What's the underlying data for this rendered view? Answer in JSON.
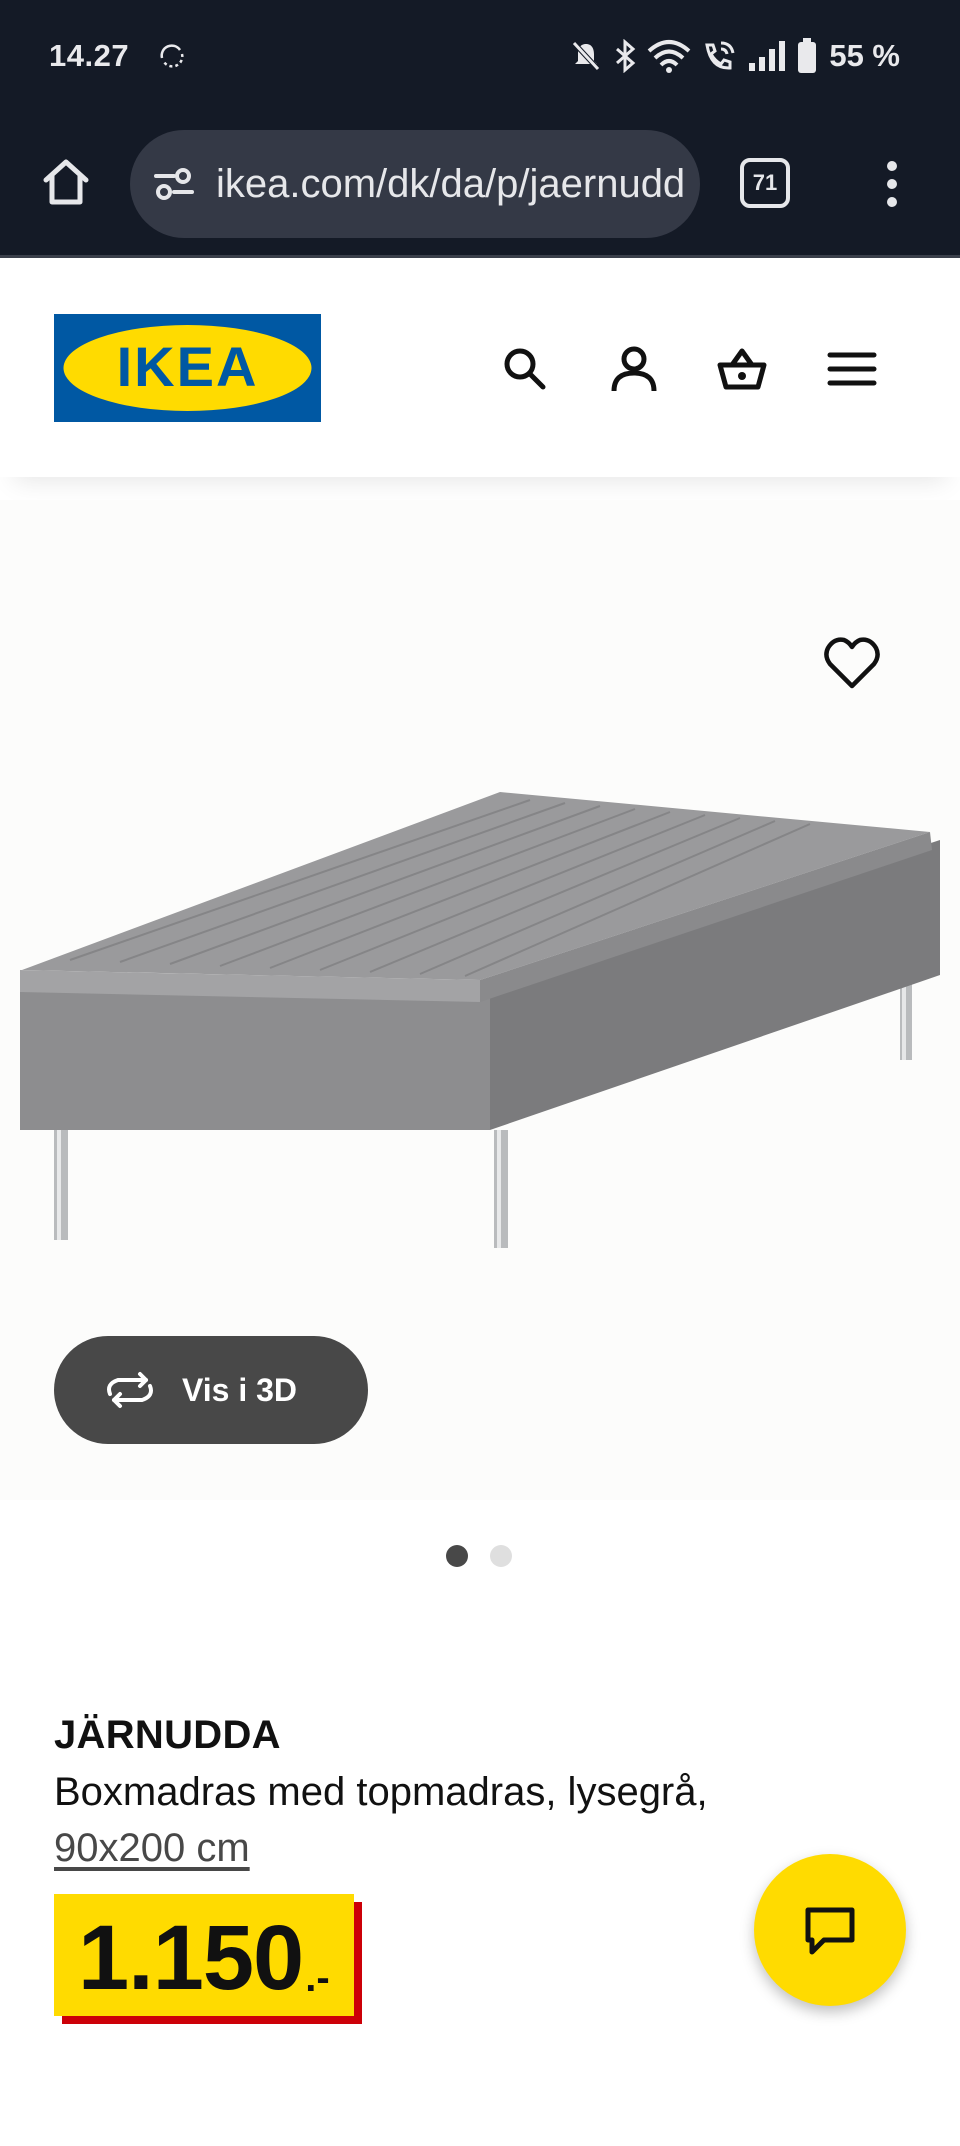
{
  "status_bar": {
    "time": "14.27",
    "battery_text": "55 %",
    "icons": [
      "sync-icon",
      "mute-icon",
      "bluetooth-icon",
      "wifi-icon",
      "wifi-calling-icon",
      "signal-icon",
      "battery-icon"
    ]
  },
  "browser": {
    "url": "ikea.com/dk/da/p/jaernudda",
    "tab_count": "71"
  },
  "header": {
    "logo_text": "IKEA",
    "icons": [
      "search-icon",
      "account-icon",
      "basket-icon",
      "hamburger-menu-icon"
    ]
  },
  "product": {
    "view3d_label": "Vis i 3D",
    "carousel": {
      "count": 2,
      "active_index": 0
    },
    "name": "JÄRNUDDA",
    "description": "Boxmadras med topmadras, lysegrå,",
    "size_link": "90x200 cm",
    "price_integer": "1.150",
    "price_suffix": ".-"
  },
  "colors": {
    "dark_bar": "#141a26",
    "ikea_blue": "#0058a3",
    "ikea_yellow": "#ffdb00",
    "price_red": "#cc0008",
    "button_dark": "#484848"
  }
}
